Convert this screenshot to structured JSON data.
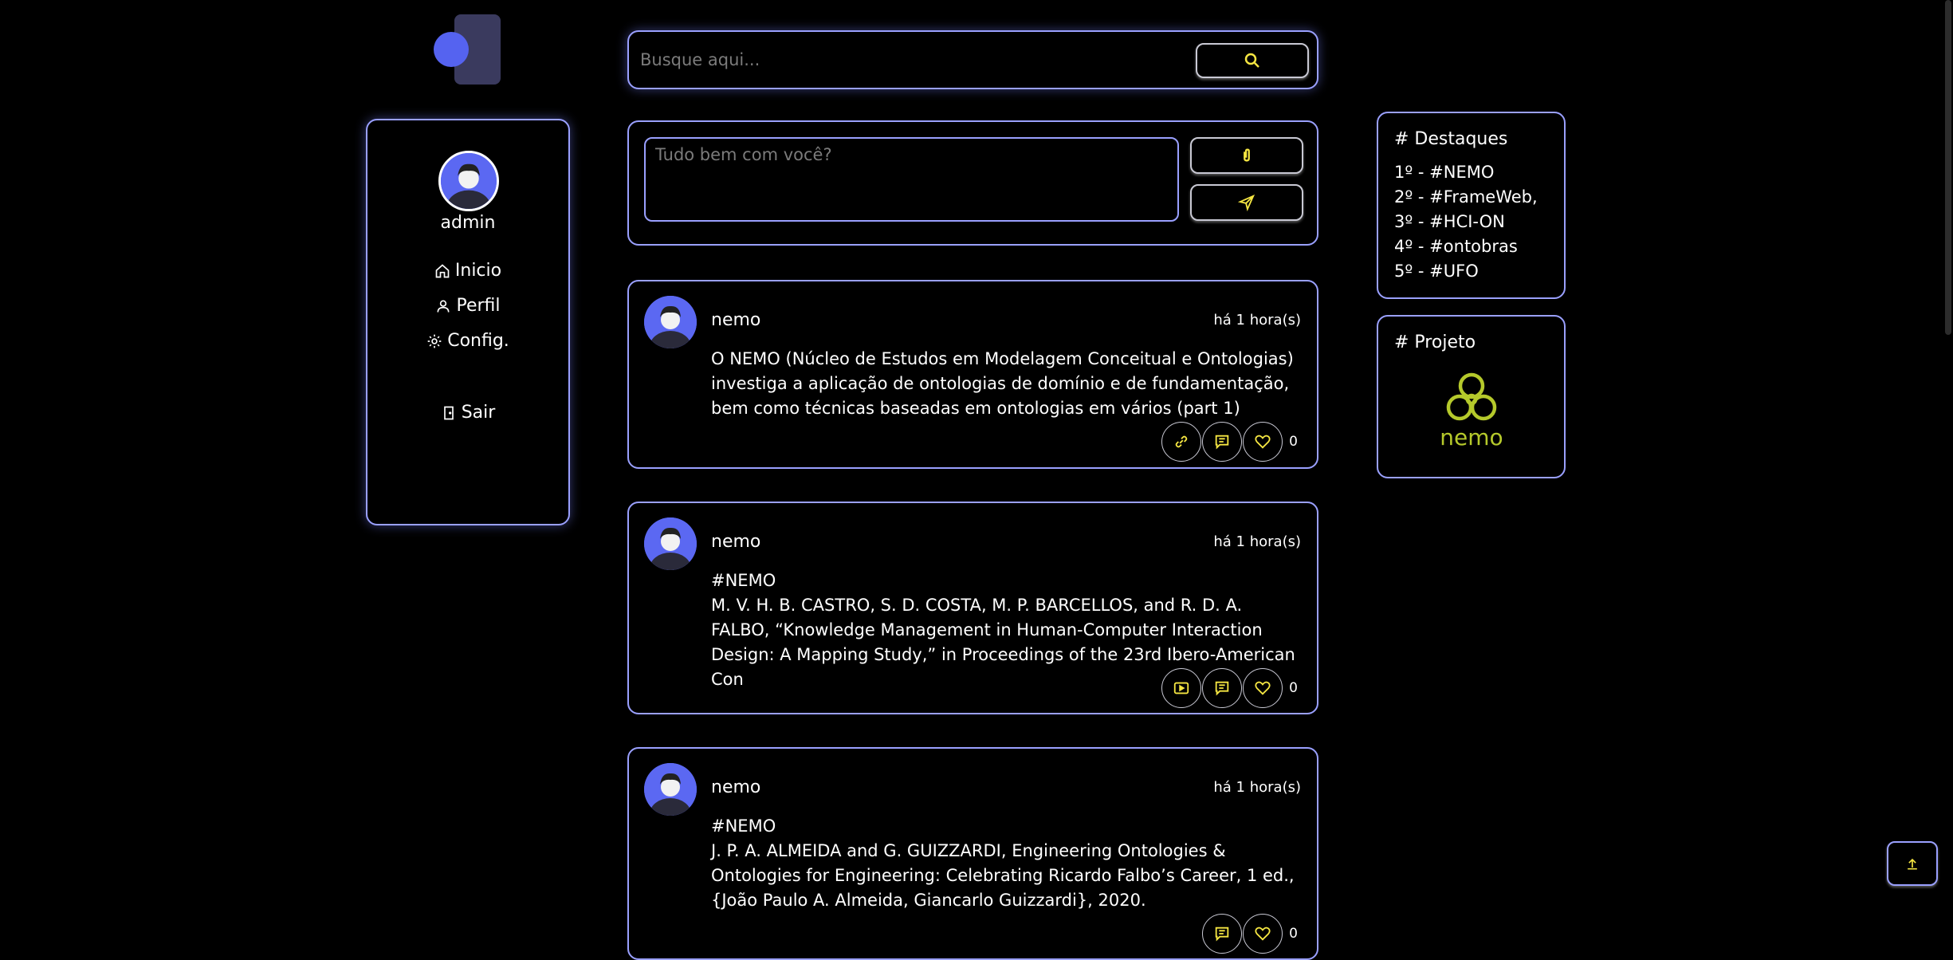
{
  "colors": {
    "accent": "#f5e642",
    "border": "#9aa0ff",
    "avatar": "#5b68f2",
    "logo_green": "#b5c92b"
  },
  "sidebar": {
    "username": "admin",
    "nav": [
      {
        "label": "Inicio",
        "icon": "home-icon"
      },
      {
        "label": "Perfil",
        "icon": "user-icon"
      },
      {
        "label": "Config.",
        "icon": "gear-icon"
      },
      {
        "label": "Sair",
        "icon": "door-icon"
      }
    ]
  },
  "search": {
    "placeholder": "Busque aqui...",
    "value": "",
    "button_icon": "search-icon"
  },
  "composer": {
    "placeholder": "Tudo bem com você?",
    "attach_icon": "paperclip-icon",
    "send_icon": "send-icon"
  },
  "posts": [
    {
      "author": "nemo",
      "time": "há 1 hora(s)",
      "tag": "",
      "text": "O NEMO (Núcleo de Estudos em Modelagem Conceitual e Ontologias) investiga a aplicação de ontologias de domínio e de fundamentação, bem como técnicas baseadas em ontologias em vários (part 1)",
      "media_icon": "link-icon",
      "likes": "0"
    },
    {
      "author": "nemo",
      "time": "há 1 hora(s)",
      "tag": "#NEMO",
      "text": "M. V. H. B. CASTRO, S. D. COSTA, M. P. BARCELLOS, and R. D. A. FALBO, “Knowledge Management in Human-Computer Interaction Design: A Mapping Study,” in Proceedings of the 23rd Ibero-American Con",
      "media_icon": "play-icon",
      "likes": "0"
    },
    {
      "author": "nemo",
      "time": "há 1 hora(s)",
      "tag": "#NEMO",
      "text": "J. P. A. ALMEIDA and G. GUIZZARDI, Engineering Ontologies & Ontologies for Engineering: Celebrating Ricardo Falbo’s Career, 1 ed., {João Paulo A. Almeida, Giancarlo Guizzardi}, 2020.",
      "media_icon": "",
      "likes": "0"
    }
  ],
  "highlights": {
    "title": "# Destaques",
    "items": [
      "1º - #NEMO",
      "2º - #FrameWeb,",
      "3º - #HCI-ON",
      "4º - #ontobras",
      "5º - #UFO"
    ]
  },
  "project": {
    "title": "# Projeto",
    "logo_text": "nemo"
  }
}
